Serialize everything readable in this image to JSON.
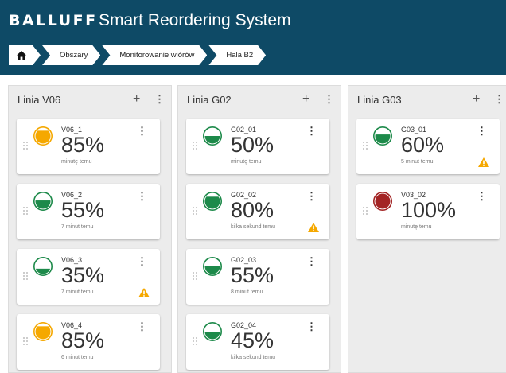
{
  "header": {
    "logo": "BALLUFF",
    "title": "Smart Reordering System",
    "background": "#0e4a66"
  },
  "breadcrumb": {
    "home_icon": "home-icon",
    "items": [
      "Obszary",
      "Monitorowanie wiórów",
      "Hala B2"
    ]
  },
  "columns": [
    {
      "title": "Linia V06",
      "add_icon": "plus-icon",
      "menu_icon": "kebab-icon",
      "cards": [
        {
          "name": "V06_1",
          "fill": "85%",
          "updated": "minutę temu",
          "fill_level": 0.85,
          "status_color": "#f5a800",
          "warning": false
        },
        {
          "name": "V06_2",
          "fill": "55%",
          "updated": "7 minut temu",
          "fill_level": 0.55,
          "status_color": "#1d8a4a",
          "warning": false
        },
        {
          "name": "V06_3",
          "fill": "35%",
          "updated": "7 minut temu",
          "fill_level": 0.35,
          "status_color": "#1d8a4a",
          "warning": true
        },
        {
          "name": "V06_4",
          "fill": "85%",
          "updated": "6 minut temu",
          "fill_level": 0.85,
          "status_color": "#f5a800",
          "warning": false
        }
      ]
    },
    {
      "title": "Linia G02",
      "add_icon": "plus-icon",
      "menu_icon": "kebab-icon",
      "cards": [
        {
          "name": "G02_01",
          "fill": "50%",
          "updated": "minutę temu",
          "fill_level": 0.5,
          "status_color": "#1d8a4a",
          "warning": false
        },
        {
          "name": "G02_02",
          "fill": "80%",
          "updated": "kilka sekund temu",
          "fill_level": 0.8,
          "status_color": "#1d8a4a",
          "warning": true
        },
        {
          "name": "G02_03",
          "fill": "55%",
          "updated": "8 minut temu",
          "fill_level": 0.55,
          "status_color": "#1d8a4a",
          "warning": false
        },
        {
          "name": "G02_04",
          "fill": "45%",
          "updated": "kilka sekund temu",
          "fill_level": 0.45,
          "status_color": "#1d8a4a",
          "warning": false
        }
      ]
    },
    {
      "title": "Linia G03",
      "add_icon": "plus-icon",
      "menu_icon": "kebab-icon",
      "cards": [
        {
          "name": "G03_01",
          "fill": "60%",
          "updated": "5 minut temu",
          "fill_level": 0.6,
          "status_color": "#1d8a4a",
          "warning": true
        },
        {
          "name": "V03_02",
          "fill": "100%",
          "updated": "minutę temu",
          "fill_level": 1.0,
          "status_color": "#a32424",
          "warning": false
        }
      ]
    }
  ],
  "warning_color": "#f5a800"
}
